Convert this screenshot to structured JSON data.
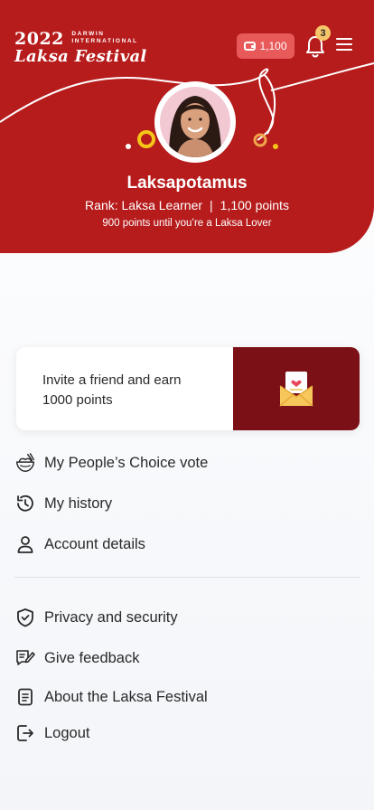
{
  "header": {
    "logo": {
      "year": "2022",
      "sub_line1": "DARWIN",
      "sub_line2": "INTERNATIONAL",
      "title": "Laksa Festival"
    },
    "wallet_points": "1,100",
    "notification_count": "3",
    "brand_color": "#b71c1c"
  },
  "profile": {
    "username": "Laksapotamus",
    "rank": "Rank: Laksa Learner",
    "points": "1,100 points",
    "rank_separator": "|",
    "until_next": "900 points until you’re a Laksa Lover"
  },
  "invite": {
    "line1": "Invite a friend and earn",
    "line2": "1000 points",
    "icon": "envelope-heart-icon"
  },
  "menu": {
    "items": [
      {
        "label": "My People’s Choice vote",
        "icon": "laksa-bowl-icon"
      },
      {
        "label": "My history",
        "icon": "history-icon"
      },
      {
        "label": "Account details",
        "icon": "user-icon"
      },
      {
        "label": "Privacy and security",
        "icon": "shield-check-icon"
      },
      {
        "label": "Give feedback",
        "icon": "feedback-edit-icon"
      },
      {
        "label": "About the Laksa Festival",
        "icon": "document-icon"
      },
      {
        "label": "Logout",
        "icon": "logout-icon"
      }
    ]
  }
}
